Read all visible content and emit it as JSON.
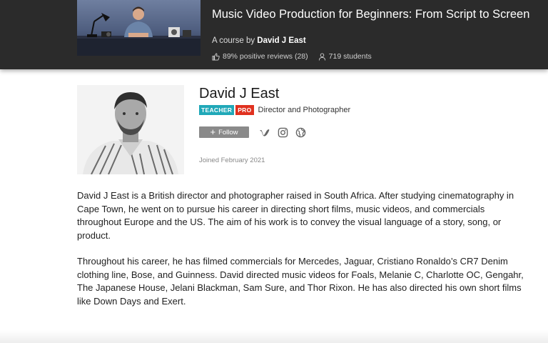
{
  "course": {
    "title": "Music Video Production for Beginners: From Script to Screen",
    "byline_prefix": "A course by",
    "byline_author": "David J East",
    "reviews": "89% positive reviews (28)",
    "students": "719 students"
  },
  "profile": {
    "name": "David J East",
    "badge_teacher": "TEACHER",
    "badge_pro": "PRO",
    "role": "Director and Photographer",
    "follow_label": "Follow",
    "joined": "Joined February 2021",
    "social_icons": [
      "vimeo-icon",
      "instagram-icon",
      "globe-icon"
    ]
  },
  "bio": {
    "p1": "David J East is a British director and photographer raised in South Africa. After studying cinematography in Cape Town, he went on to pursue his career in directing short films, music videos, and commercials throughout Europe and the US. The aim of his work is to convey the visual language of a story, song, or product.",
    "p2": "Throughout his career, he has filmed commercials for Mercedes, Jaguar, Cristiano Ronaldo’s CR7 Denim clothing line, Bose, and Guinness. David directed music videos for Foals, Melanie C, Charlotte OC, Gengahr, The Japanese House, Jelani Blackman, Sam Sure, and Thor Rixon. He has also directed his own short films like Down Days and Exert."
  },
  "colors": {
    "header_bg": "#2b2b2b",
    "teacher_badge": "#20a8b8",
    "pro_badge": "#e0311f",
    "follow_bg": "#8a8a8a"
  }
}
